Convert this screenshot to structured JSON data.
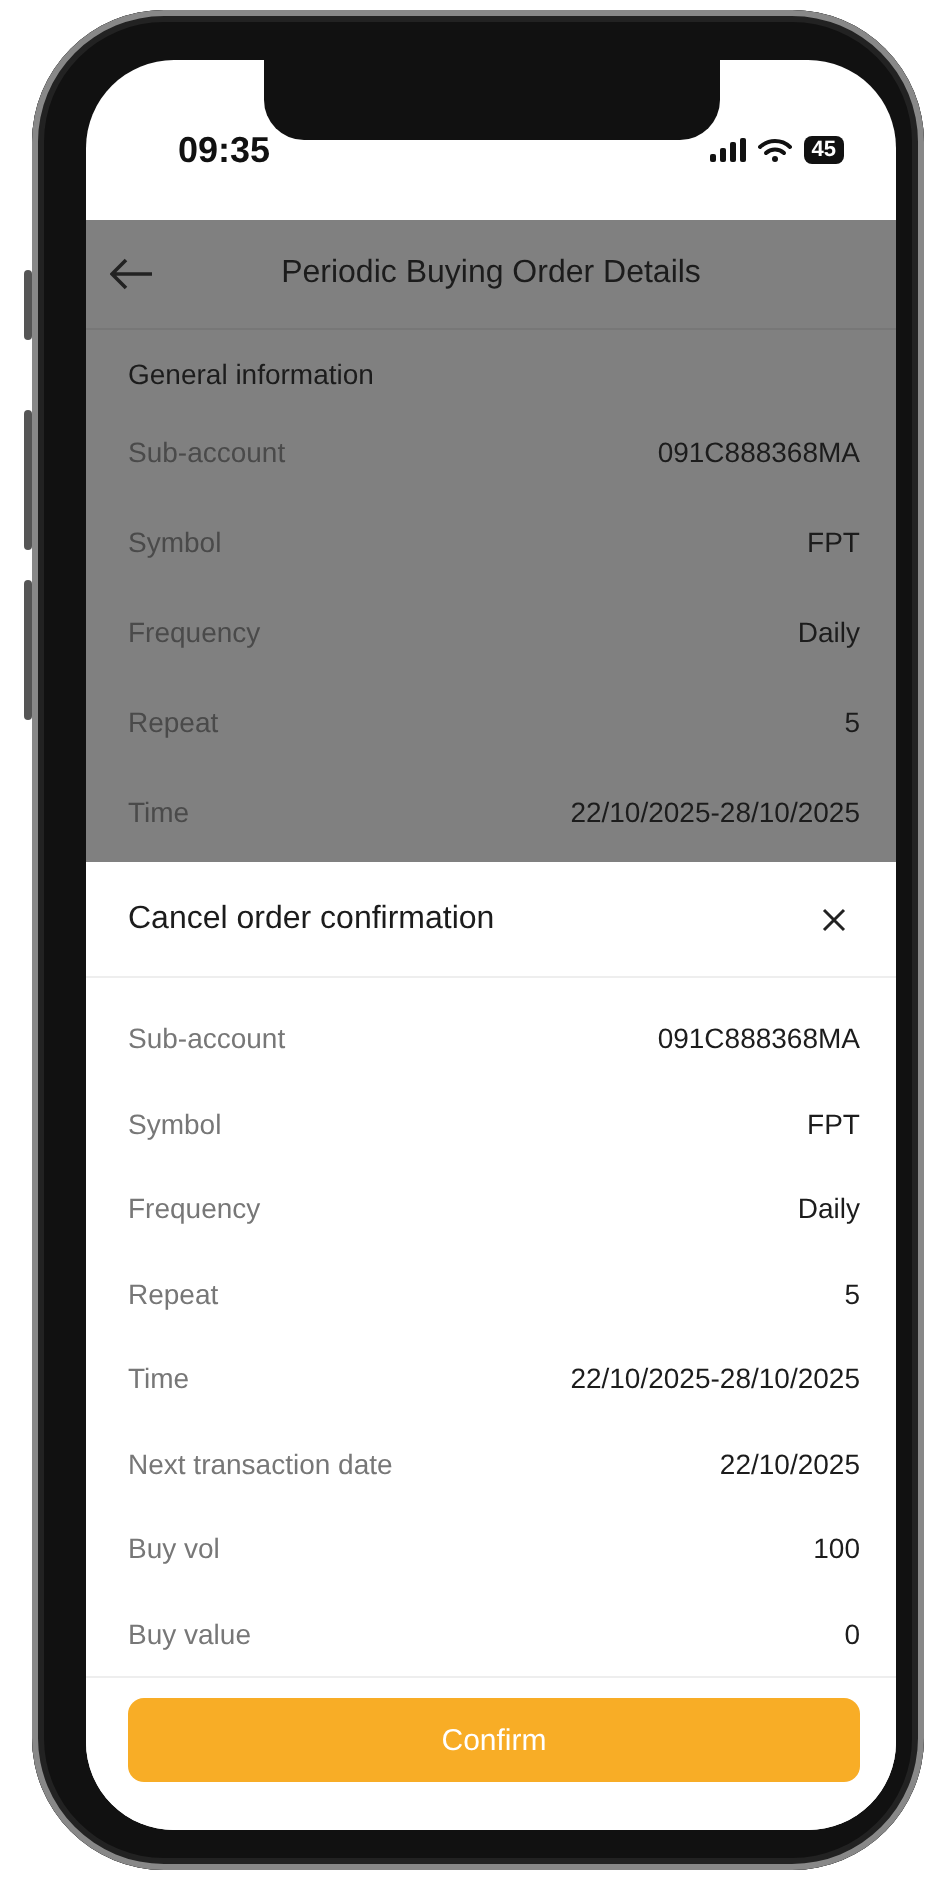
{
  "status_bar": {
    "time": "09:35",
    "battery": "45"
  },
  "header": {
    "title": "Periodic Buying Order Details"
  },
  "general": {
    "heading": "General information",
    "rows": [
      {
        "label": "Sub-account",
        "value": "091C888368MA"
      },
      {
        "label": "Symbol",
        "value": "FPT"
      },
      {
        "label": "Frequency",
        "value": "Daily"
      },
      {
        "label": "Repeat",
        "value": "5"
      },
      {
        "label": "Time",
        "value": "22/10/2025-28/10/2025"
      }
    ]
  },
  "sheet": {
    "title": "Cancel order confirmation",
    "rows": [
      {
        "label": "Sub-account",
        "value": "091C888368MA"
      },
      {
        "label": "Symbol",
        "value": "FPT"
      },
      {
        "label": "Frequency",
        "value": "Daily"
      },
      {
        "label": "Repeat",
        "value": "5"
      },
      {
        "label": "Time",
        "value": "22/10/2025-28/10/2025"
      },
      {
        "label": "Next transaction date",
        "value": "22/10/2025"
      },
      {
        "label": "Buy vol",
        "value": "100"
      },
      {
        "label": "Buy value",
        "value": "0"
      }
    ],
    "button": "Confirm"
  }
}
